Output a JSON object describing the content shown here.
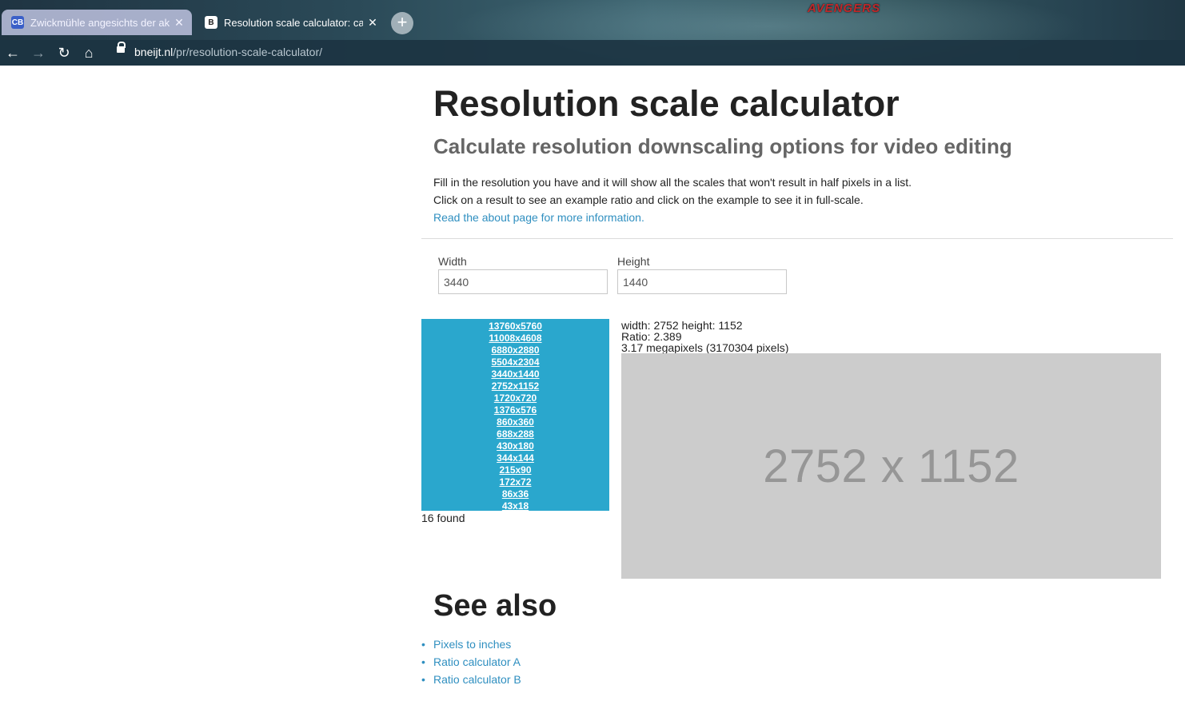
{
  "browser": {
    "tabs": [
      {
        "title": "Zwickmühle angesichts der aktue",
        "favicon": "CB",
        "active": false
      },
      {
        "title": "Resolution scale calculator: calcul",
        "favicon": "B",
        "active": true
      }
    ],
    "new_tab_label": "+",
    "close_label": "✕",
    "banner_logo": "AVENGERS",
    "url": {
      "host": "bneijt.nl",
      "path": "/pr/resolution-scale-calculator/"
    }
  },
  "page": {
    "title": "Resolution scale calculator",
    "subtitle": "Calculate resolution downscaling options for video editing",
    "intro_line1": "Fill in the resolution you have and it will show all the scales that won't result in half pixels in a list.",
    "intro_line2": "Click on a result to see an example ratio and click on the example to see it in full-scale.",
    "about_link": "Read the about page for more information",
    "about_link_suffix": "."
  },
  "form": {
    "width": {
      "label": "Width",
      "value": "3440"
    },
    "height": {
      "label": "Height",
      "value": "1440"
    }
  },
  "results": {
    "items": [
      "13760x5760",
      "11008x4608",
      "6880x2880",
      "5504x2304",
      "3440x1440",
      "2752x1152",
      "1720x720",
      "1376x576",
      "860x360",
      "688x288",
      "430x180",
      "344x144",
      "215x90",
      "172x72",
      "86x36",
      "43x18"
    ],
    "found_text": "16 found"
  },
  "selection": {
    "dims_line": "width: 2752 height: 1152",
    "ratio_line": "Ratio: 2.389",
    "megapixels_line": "3.17 megapixels (3170304 pixels)",
    "preview_text": "2752 x 1152"
  },
  "see_also": {
    "heading": "See also",
    "links": [
      "Pixels to inches",
      "Ratio calculator A",
      "Ratio calculator B"
    ]
  }
}
